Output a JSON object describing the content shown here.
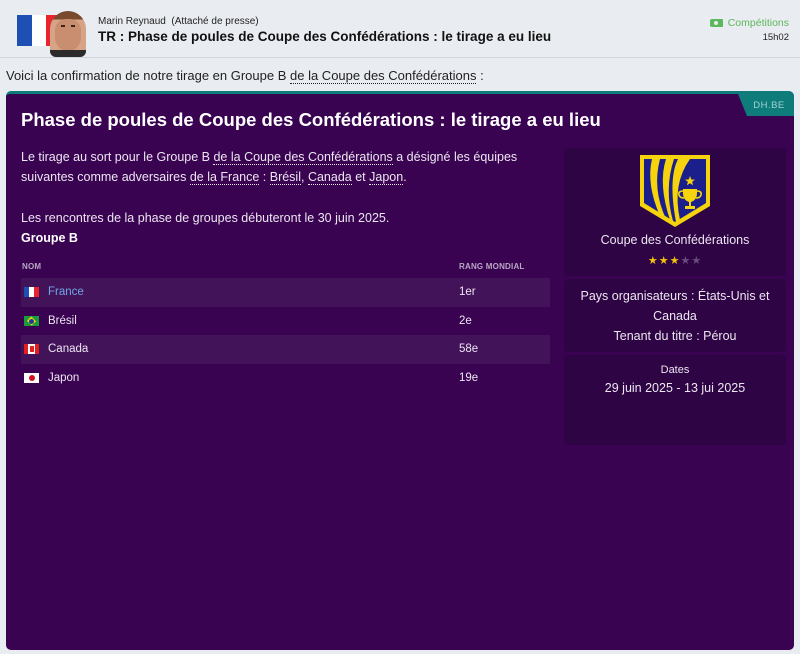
{
  "header": {
    "sender_name": "Marin Reynaud",
    "sender_role": "(Attaché de presse)",
    "subject": "TR : Phase de poules de Coupe des Confédérations : le tirage a eu lieu",
    "tag_icon": "tag-icon",
    "tag_label": "Compétitions",
    "time": "15h02",
    "nation_flag": "france-flag",
    "flag_colors": [
      "#1e50b4",
      "#ffffff",
      "#e8252e"
    ]
  },
  "intro": {
    "prefix": "Voici la confirmation de notre tirage en Groupe B ",
    "link": "de la Coupe des Confédérations",
    "suffix": " :"
  },
  "card": {
    "source": "DH.BE",
    "title": "Phase de poules de Coupe des Confédérations : le tirage a eu lieu",
    "para1": {
      "t1": "Le tirage au sort pour le Groupe B ",
      "link1": "de la Coupe des Confédérations",
      "t2": " a désigné les équipes suivantes comme adversaires ",
      "link2": "de la France",
      "t3": " : ",
      "link3": "Brésil",
      "t4": ", ",
      "link4": "Canada",
      "t5": " et ",
      "link5": "Japon",
      "t6": "."
    },
    "para2": "Les rencontres de la phase de groupes débuteront le 30 juin 2025.",
    "group_label": "Groupe B",
    "table": {
      "headers": [
        "NOM",
        "RANG MONDIAL"
      ],
      "rows": [
        {
          "team": "France",
          "rank": "1er",
          "flag": "france-flag",
          "highlight": true
        },
        {
          "team": "Brésil",
          "rank": "2e",
          "flag": "brazil-flag",
          "highlight": false
        },
        {
          "team": "Canada",
          "rank": "58e",
          "flag": "canada-flag",
          "highlight": false
        },
        {
          "team": "Japon",
          "rank": "19e",
          "flag": "japan-flag",
          "highlight": false
        }
      ]
    }
  },
  "side": {
    "competition_logo": "confederations-cup-crest-icon",
    "competition_name": "Coupe des Confédérations",
    "rating": {
      "filled": 3,
      "total": 5
    },
    "hosts": "Pays organisateurs : États-Unis et Canada",
    "holder": "Tenant du titre : Pérou",
    "dates_label": "Dates",
    "dates_value": "29 juin 2025 - 13 jui 2025"
  },
  "colors": {
    "card_bg": "#390351",
    "accent_teal": "#0e7c7b",
    "link_blue": "#6fa7e6",
    "tag_green": "#5cb85c",
    "star_gold": "#f4c20d"
  }
}
